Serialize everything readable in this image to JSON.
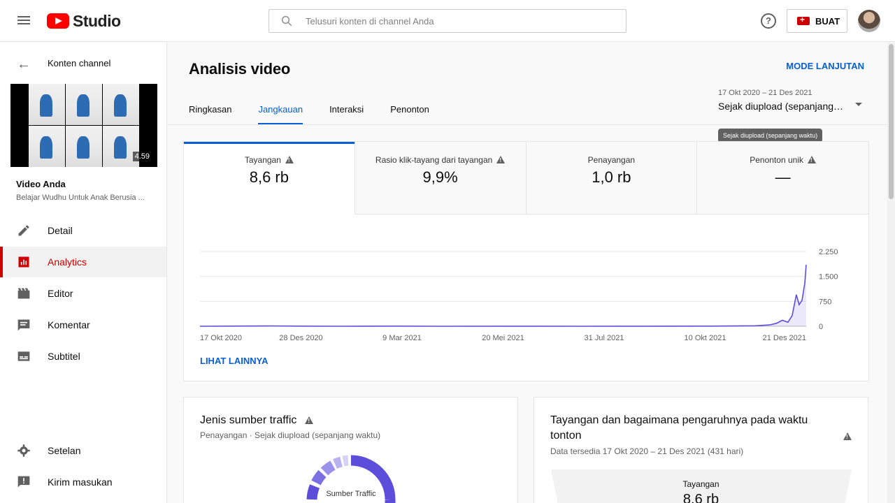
{
  "topbar": {
    "logo_text": "Studio",
    "search_placeholder": "Telusuri konten di channel Anda",
    "help_glyph": "?",
    "create_label": "BUAT"
  },
  "sidebar": {
    "back_label": "Konten channel",
    "video_duration": "4.59",
    "video_heading": "Video Anda",
    "video_title": "Belajar Wudhu Untuk Anak Berusia ...",
    "items": [
      {
        "label": "Detail",
        "icon": "pencil-icon"
      },
      {
        "label": "Analytics",
        "icon": "analytics-icon",
        "active": true
      },
      {
        "label": "Editor",
        "icon": "film-icon"
      },
      {
        "label": "Komentar",
        "icon": "comment-icon"
      },
      {
        "label": "Subtitel",
        "icon": "subtitle-icon"
      }
    ],
    "bottom_items": [
      {
        "label": "Setelan",
        "icon": "gear-icon"
      },
      {
        "label": "Kirim masukan",
        "icon": "feedback-icon"
      }
    ]
  },
  "main": {
    "title": "Analisis video",
    "advanced_mode": "MODE LANJUTAN",
    "tabs": [
      "Ringkasan",
      "Jangkauan",
      "Interaksi",
      "Penonton"
    ],
    "active_tab": 1,
    "date_range": {
      "dates": "17 Okt 2020 – 21 Des 2021",
      "period": "Sejak diupload (sepanjang waktu)",
      "tooltip": "Sejak diupload (sepanjang waktu)"
    },
    "metrics": [
      {
        "label": "Tayangan",
        "value": "8,6 rb",
        "warning": true
      },
      {
        "label": "Rasio klik-tayang dari tayangan",
        "value": "9,9%",
        "warning": true
      },
      {
        "label": "Penayangan",
        "value": "1,0 rb",
        "warning": false
      },
      {
        "label": "Penonton unik",
        "value": "—",
        "warning": true
      }
    ],
    "see_more": "LIHAT LAINNYA",
    "traffic_card": {
      "title": "Jenis sumber traffic",
      "subtitle": "Penayangan · Sejak diupload (sepanjang waktu)",
      "center_label": "Sumber Traffic"
    },
    "impressions_card": {
      "title": "Tayangan dan bagaimana pengaruhnya pada waktu tonton",
      "subtitle": "Data tersedia 17 Okt 2020 – 21 Des 2021 (431 hari)",
      "funnel_label": "Tayangan",
      "funnel_value": "8,6 rb"
    }
  },
  "colors": {
    "accent_blue": "#065fd4",
    "brand_red": "#ff0000",
    "active_red": "#cc0000",
    "chart_line": "#5c4ddb"
  },
  "chart_data": {
    "type": "line",
    "series": [
      {
        "values": [
          [
            0,
            0
          ],
          [
            20,
            5
          ],
          [
            50,
            10
          ],
          [
            70,
            5
          ],
          [
            100,
            0
          ],
          [
            140,
            4
          ],
          [
            170,
            0
          ],
          [
            220,
            2
          ],
          [
            270,
            0
          ],
          [
            320,
            3
          ],
          [
            360,
            5
          ],
          [
            380,
            8
          ],
          [
            395,
            15
          ],
          [
            405,
            40
          ],
          [
            410,
            90
          ],
          [
            414,
            180
          ],
          [
            418,
            120
          ],
          [
            421,
            320
          ],
          [
            424,
            950
          ],
          [
            426,
            650
          ],
          [
            428,
            780
          ],
          [
            430,
            1300
          ],
          [
            431,
            1850
          ]
        ]
      }
    ],
    "x_ticks": [
      "17 Okt 2020",
      "28 Des 2020",
      "9 Mar 2021",
      "20 Mei 2021",
      "31 Jul 2021",
      "10 Okt 2021",
      "21 Des 2021"
    ],
    "y_ticks": [
      "2.250",
      "1.500",
      "750",
      "0"
    ],
    "y_tick_values": [
      2250,
      1500,
      750,
      0
    ],
    "xlim": [
      0,
      431
    ],
    "ylim": [
      0,
      2250
    ],
    "grid": true,
    "xlabel": "",
    "ylabel": ""
  }
}
